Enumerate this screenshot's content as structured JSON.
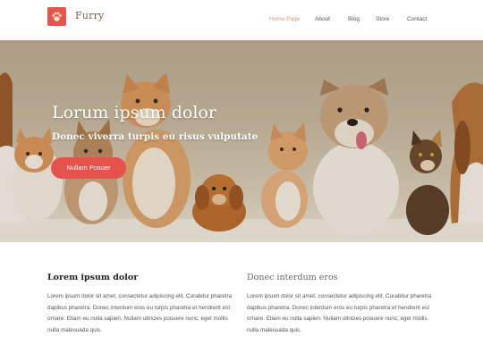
{
  "header": {
    "brand": "Furry",
    "nav": [
      {
        "label": "Home Page",
        "active": true
      },
      {
        "label": "About",
        "active": false
      },
      {
        "label": "Blog",
        "active": false
      },
      {
        "label": "Store",
        "active": false
      },
      {
        "label": "Contact",
        "active": false
      }
    ]
  },
  "hero": {
    "title": "Lorum ipsum dolor",
    "subtitle": "Donec viverra turpis eu risus vulputate",
    "button_label": "Nullam Posuer"
  },
  "columns": [
    {
      "heading": "Lorem ipsum dolor",
      "body": "Lorem ipsum dolor sit amet, consectetur adipiscing elit. Curabitur pharetra dapibus pharetra. Donec interdum eros eu turpis pharetra et hendrerit est ornare. Etiam eu nulla sapien. Nullam ultricies posuere nunc, eget mollis nulla malesuada quis."
    },
    {
      "heading": "Donec interdum eros",
      "body": "Lorem ipsum dolor sit amet, consectetur adipiscing elit. Curabitur pharetra dapibus pharetra. Donec interdum eros eu turpis pharetra et hendrerit est ornare. Etiam eu nulla sapien. Nullam ultricies posuere nunc, eget mollis nulla malesuada quis."
    }
  ],
  "colors": {
    "accent": "#e5524c",
    "brand_text": "#7a5c4a",
    "nav_active": "#c89a7e"
  },
  "icons": {
    "logo": "paw-icon"
  }
}
